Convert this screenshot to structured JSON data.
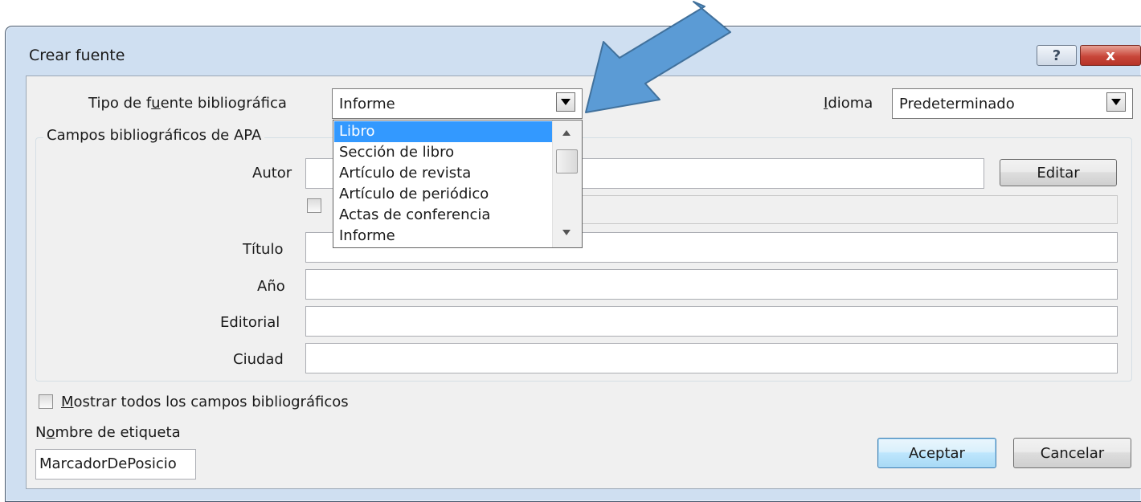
{
  "window": {
    "title": "Crear fuente",
    "help_glyph": "?",
    "close_glyph": "x"
  },
  "source_type": {
    "label_pre": "Tipo de f",
    "label_u": "u",
    "label_post": "ente bibliográfica",
    "value": "Informe",
    "options": [
      "Libro",
      "Sección de libro",
      "Artículo de revista",
      "Artículo de periódico",
      "Actas de conferencia",
      "Informe"
    ],
    "selected_option": "Libro"
  },
  "language": {
    "label_pre": "",
    "label_u": "I",
    "label_post": "dioma",
    "label_pre2": "",
    "value": "Predeterminado"
  },
  "group": {
    "legend": "Campos bibliográficos de APA"
  },
  "fields": {
    "author_label": "Autor",
    "edit_button": "Editar",
    "title_label": "Título",
    "year_label": "Año",
    "publisher_label": "Editorial",
    "city_label": "Ciudad"
  },
  "show_all": {
    "label_u": "M",
    "label_post": "ostrar todos los campos bibliográficos"
  },
  "tag_name": {
    "label_pre": "N",
    "label_u": "o",
    "label_post": "mbre de etiqueta",
    "value": "MarcadorDePosicio"
  },
  "buttons": {
    "ok": "Aceptar",
    "cancel": "Cancelar"
  },
  "colors": {
    "selection": "#3399ff",
    "annotation_arrow": "#5b9bd5",
    "close_button": "#c9473a"
  }
}
